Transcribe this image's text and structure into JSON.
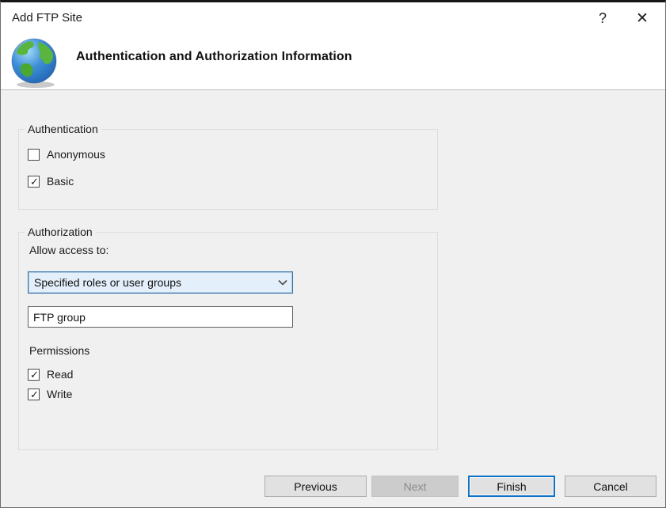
{
  "window": {
    "title": "Add FTP Site",
    "icons": {
      "help": "?",
      "close": "✕"
    }
  },
  "header": {
    "title": "Authentication and Authorization Information",
    "icon": "globe-icon"
  },
  "authentication": {
    "group_label": "Authentication",
    "checkboxes": [
      {
        "label": "Anonymous",
        "checked": false
      },
      {
        "label": "Basic",
        "checked": true
      }
    ]
  },
  "authorization": {
    "group_label": "Authorization",
    "allow_access_label": "Allow access to:",
    "access_select": {
      "value": "Specified roles or user groups",
      "icon": "chevron-down-icon"
    },
    "users_input": {
      "value": "FTP group",
      "placeholder": ""
    },
    "permissions_label": "Permissions",
    "permissions": [
      {
        "label": "Read",
        "checked": true
      },
      {
        "label": "Write",
        "checked": true
      }
    ]
  },
  "footer": {
    "buttons": [
      {
        "label": "Previous",
        "disabled": false,
        "default": false
      },
      {
        "label": "Next",
        "disabled": true,
        "default": false
      },
      {
        "label": "Finish",
        "disabled": false,
        "default": true
      },
      {
        "label": "Cancel",
        "disabled": false,
        "default": false
      }
    ]
  },
  "colors": {
    "accent": "#0c72c7",
    "combo_border": "#2f6fa7",
    "combo_fill": "#e3effa",
    "body_bg": "#f0f0f0",
    "header_bg": "#ffffff",
    "disabled_button_bg": "#cccccc"
  }
}
